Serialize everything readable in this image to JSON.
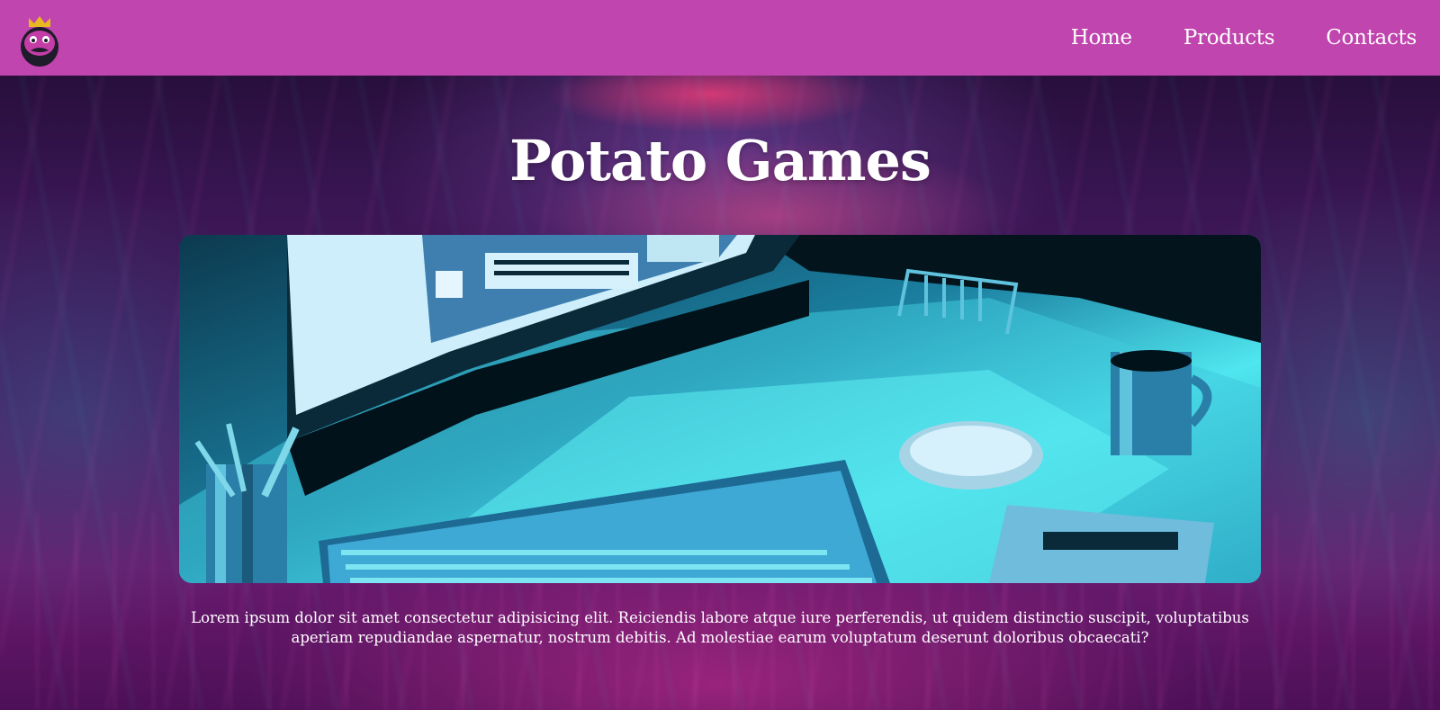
{
  "brand": {
    "logo_icon": "potato-king-mascot-icon",
    "accent_color": "#c045ae"
  },
  "nav": {
    "items": [
      {
        "label": "Home"
      },
      {
        "label": "Products"
      },
      {
        "label": "Contacts"
      }
    ]
  },
  "hero": {
    "title": "Potato Games",
    "image_icon": "pixel-art-desk-illustration",
    "description": "Lorem ipsum dolor sit amet consectetur adipisicing elit. Reiciendis labore atque iure perferendis, ut quidem distinctio suscipit, voluptatibus aperiam repudiandae aspernatur, nostrum debitis. Ad molestiae earum voluptatum deserunt doloribus obcaecati?"
  }
}
